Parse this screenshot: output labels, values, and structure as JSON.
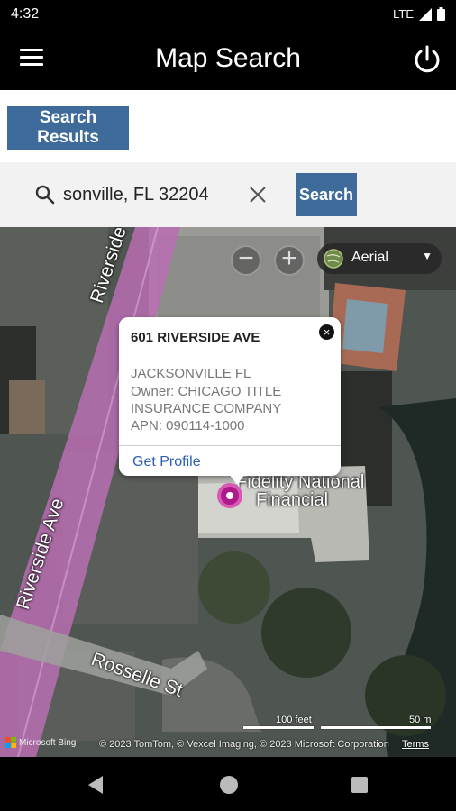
{
  "status_bar": {
    "time": "4:32",
    "network": "LTE"
  },
  "app_bar": {
    "title": "Map Search",
    "menu_icon": "hamburger-menu-icon",
    "power_icon": "power-icon"
  },
  "results_button": {
    "label": "Search Results"
  },
  "search": {
    "value": "sonville, FL 32204",
    "search_icon": "search-icon",
    "clear_icon": "close-icon",
    "button_label": "Search"
  },
  "map": {
    "zoom_out": "−",
    "zoom_in": "+",
    "style_select": "Aerial",
    "popup": {
      "address": "601 RIVERSIDE AVE",
      "city": "JACKSONVILLE FL",
      "owner_line1": "Owner: CHICAGO TITLE",
      "owner_line2": "INSURANCE COMPANY",
      "apn": "APN: 090114-1000",
      "link": "Get Profile",
      "close": "×"
    },
    "labels": {
      "road1": "Riverside Ave",
      "road2": "Riverside Ave",
      "road3": "Rosselle St",
      "building_line1": "Fidelity National",
      "building_line2": "Financial"
    },
    "scale": {
      "feet": "100 feet",
      "meters": "50 m"
    },
    "attribution": "© 2023 TomTom, © Vexcel Imaging, © 2023 Microsoft Corporation",
    "terms": "Terms",
    "logo": "Microsoft Bing"
  },
  "colors": {
    "accent": "#3e6b99",
    "link": "#2b5fb4",
    "pin": "#b0198a",
    "road_overlay": "#b86fb3"
  }
}
